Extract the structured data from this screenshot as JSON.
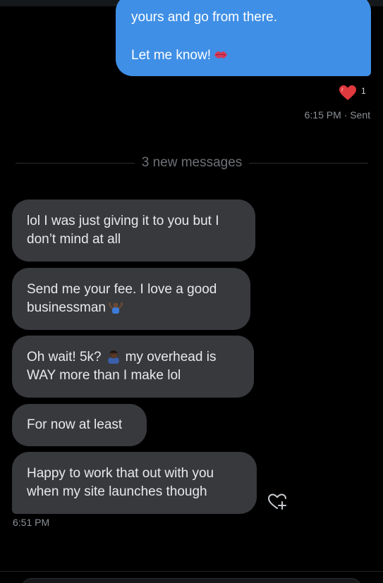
{
  "outgoing": {
    "line1": "yours and go from there.",
    "line2": "Let me know!",
    "emoji": "kiss-mark",
    "reaction": {
      "icon": "red-heart",
      "count": "1"
    },
    "meta": "6:15 PM · Sent"
  },
  "divider": {
    "label": "3 new messages"
  },
  "incoming": [
    {
      "lines": [
        "lol I was just giving it to you but I",
        "don’t mind at all"
      ]
    },
    {
      "lines": [
        "Send me your fee. I love a good",
        "businessman"
      ],
      "emoji": "person-shrugging"
    },
    {
      "lines": [
        "Oh wait! 5k?",
        "my overhead is",
        "WAY more than I make lol"
      ],
      "emoji": "person-facepalming"
    },
    {
      "lines": [
        "For now at least"
      ]
    },
    {
      "lines": [
        "Happy to work that out with you",
        "when my site launches though"
      ]
    }
  ],
  "incoming_time": "6:51 PM",
  "colors": {
    "outgoing_bubble": "#3f8fe6",
    "incoming_bubble": "#37393d",
    "background": "#000000",
    "heart": "#e0393e"
  }
}
